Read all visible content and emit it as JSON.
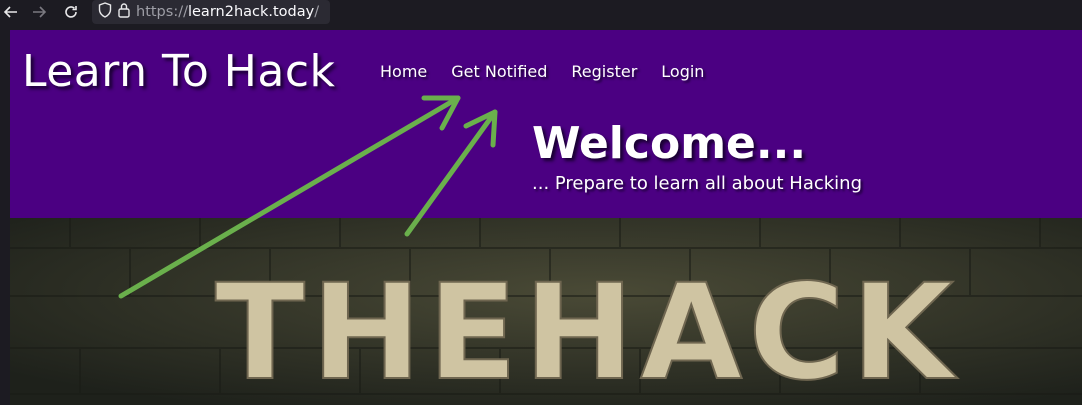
{
  "browser": {
    "url_scheme": "https://",
    "url_host": "learn2hack.today",
    "url_path": "/"
  },
  "site": {
    "logo": "Learn To Hack",
    "nav": [
      "Home",
      "Get Notified",
      "Register",
      "Login"
    ],
    "welcome": "Welcome...",
    "tagline": "... Prepare to learn all about Hacking",
    "banner_text": "THEHACK"
  },
  "colors": {
    "header_bg": "#4b0082",
    "arrow": "#6ab04c",
    "banner_letters": "#cfc4a2"
  },
  "icons": [
    "back-arrow-icon",
    "forward-arrow-icon",
    "reload-icon",
    "shield-icon",
    "lock-icon"
  ]
}
